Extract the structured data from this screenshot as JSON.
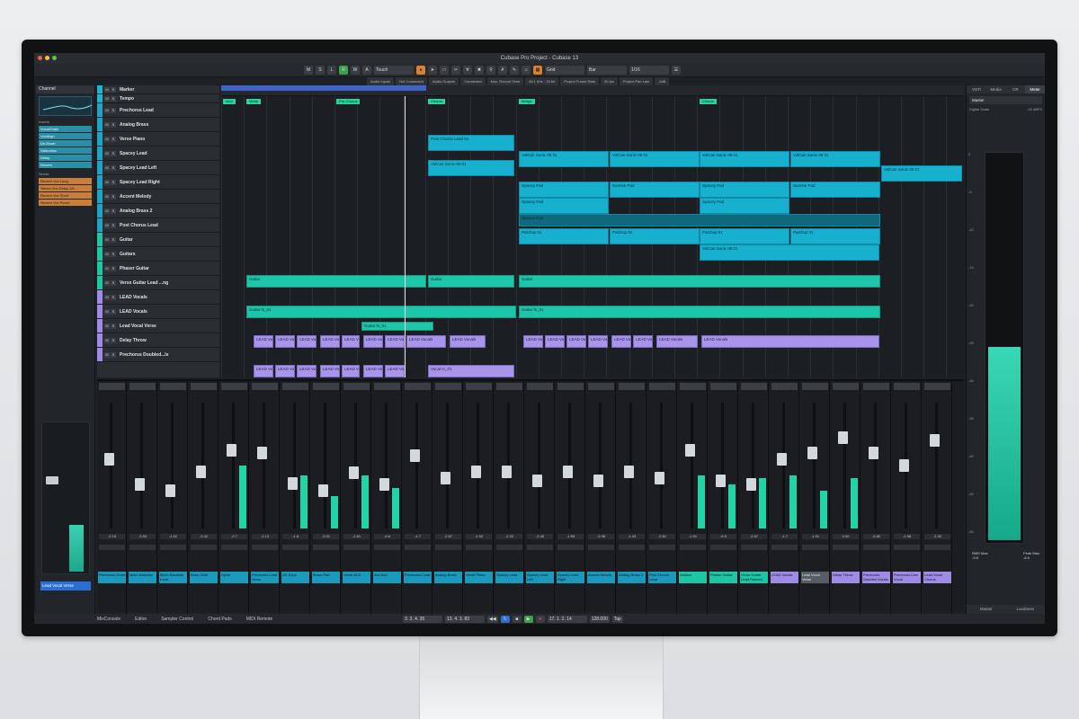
{
  "window": {
    "title": "Cubase Pro Project - Cubase 13"
  },
  "toolbar": {
    "automation_mode": "Touch",
    "snap_type": "Grid",
    "grid_value": "Bar",
    "quantize": "1/16",
    "buttons": [
      "M",
      "S",
      "L",
      "R",
      "W",
      "A"
    ]
  },
  "infobar": {
    "items": [
      "Audio Inputs",
      "Not Connected",
      "Audio Outputs",
      "Connected",
      "Max. Record Time",
      "48.1 kHz - 24 bit",
      "Project Frame Rate",
      "30 fps",
      "Project Pan Law",
      "-3dB"
    ]
  },
  "inspector": {
    "title": "Channel",
    "inserts_label": "Inserts",
    "inserts": [
      "VocalChain",
      "VoxAlign",
      "De-Esser",
      "Saturation",
      "Delay",
      "Reverb"
    ],
    "sends_label": "Sends",
    "sends": [
      "Reverb Vox Long",
      "Stereo Vox Delay 1/8",
      "Reverb Vox Short",
      "Reverb Vox Room"
    ],
    "fader_value": "0.00",
    "channel_name": "Lead Vocal Verse"
  },
  "tracks": [
    {
      "name": "Marker",
      "color": "#1bb7d1"
    },
    {
      "name": "Tempo",
      "color": "#1bb7d1"
    },
    {
      "name": "Prechorus Lead",
      "color": "#1fa3c4"
    },
    {
      "name": "Analog Brass",
      "color": "#1fa3c4"
    },
    {
      "name": "Verse Piano",
      "color": "#1fa3c4"
    },
    {
      "name": "Spacey Lead",
      "color": "#1fa3c4"
    },
    {
      "name": "Spacey Lead Left",
      "color": "#1fa3c4"
    },
    {
      "name": "Spacey Lead Right",
      "color": "#1fa3c4"
    },
    {
      "name": "Accent Melody",
      "color": "#1fa3c4"
    },
    {
      "name": "Analog Brass 2",
      "color": "#1fa3c4"
    },
    {
      "name": "Post Chorus Lead",
      "color": "#1fa3c4"
    },
    {
      "name": "Guitar",
      "color": "#1cc7a5"
    },
    {
      "name": "Guitars",
      "color": "#1cc7a5"
    },
    {
      "name": "Phaser Guitar",
      "color": "#1cc7a5"
    },
    {
      "name": "Verse Guitar Lead ...ng",
      "color": "#1cc7a5"
    },
    {
      "name": "LEAD Vocals",
      "color": "#9f8ae6"
    },
    {
      "name": "LEAD Vocals",
      "color": "#9f8ae6"
    },
    {
      "name": "Lead Vocal Verse",
      "color": "#9f8ae6"
    },
    {
      "name": "Delay Throw",
      "color": "#9f8ae6"
    },
    {
      "name": "Prechorus Doubled...ls",
      "color": "#9f8ae6"
    }
  ],
  "arrange": {
    "markers": [
      "Intro",
      "Verse",
      "Pre-Chorus",
      "Chorus",
      "Bridge",
      "Chorus"
    ],
    "clip_labels": {
      "post_chorus": "Post Chorus Lead 01",
      "volcan": "VolCan Sonic 08 01",
      "spacey": "Spacey Pad",
      "sunrise": "Sunrise Pad",
      "patchup": "Patchup 01",
      "guitar": "Guitar",
      "guitar_hi": "Guitar hi_01",
      "lead_vocals": "LEAD Vocals",
      "vocal_in": "Vocal In_01"
    }
  },
  "mixer": {
    "strips": [
      {
        "name": "Prechorus Dead",
        "value": "-2.15",
        "color": "blue",
        "fader": 0.55,
        "meter": 0
      },
      {
        "name": "Mach Bassline",
        "value": "-3.53",
        "color": "blue",
        "fader": 0.35,
        "meter": 0
      },
      {
        "name": "Mach Bassline Lead",
        "value": "-1.52",
        "color": "blue",
        "fader": 0.3,
        "meter": 0
      },
      {
        "name": "Bass Glide",
        "value": "-3.42",
        "color": "blue",
        "fader": 0.45,
        "meter": 0
      },
      {
        "name": "Synth",
        "value": "-2.7",
        "color": "blue",
        "fader": 0.62,
        "meter": 0.5
      },
      {
        "name": "Prechorus Lead Verse",
        "value": "-1.13",
        "color": "blue",
        "fader": 0.6,
        "meter": 0
      },
      {
        "name": "UK Keys",
        "value": "-1.8",
        "color": "blue",
        "fader": 0.36,
        "meter": 0.42
      },
      {
        "name": "Brass Pad",
        "value": "-3.01",
        "color": "blue",
        "fader": 0.3,
        "meter": 0.26
      },
      {
        "name": "Verse ACD",
        "value": "-2.81",
        "color": "blue",
        "fader": 0.44,
        "meter": 0.42
      },
      {
        "name": "Acc Acd",
        "value": "-6.6",
        "color": "blue",
        "fader": 0.35,
        "meter": 0.32
      },
      {
        "name": "Prechorus Lead",
        "value": "-1.7",
        "color": "blue",
        "fader": 0.58,
        "meter": 0
      },
      {
        "name": "Analog Brass",
        "value": "-2.67",
        "color": "blue",
        "fader": 0.4,
        "meter": 0
      },
      {
        "name": "Verse Piano",
        "value": "-1.52",
        "color": "blue",
        "fader": 0.45,
        "meter": 0
      },
      {
        "name": "Spacey Lead",
        "value": "-2.22",
        "color": "blue",
        "fader": 0.45,
        "meter": 0
      },
      {
        "name": "Spacey Lead Left",
        "value": "-2.45",
        "color": "blue",
        "fader": 0.38,
        "meter": 0
      },
      {
        "name": "Spacey Lead Right",
        "value": "-1.55",
        "color": "blue",
        "fader": 0.45,
        "meter": 0
      },
      {
        "name": "Accent Melody",
        "value": "-2.08",
        "color": "blue",
        "fader": 0.38,
        "meter": 0
      },
      {
        "name": "Analog Brass 2",
        "value": "-1.43",
        "color": "blue",
        "fader": 0.45,
        "meter": 0
      },
      {
        "name": "Post Chorus Lead",
        "value": "-2.81",
        "color": "blue",
        "fader": 0.4,
        "meter": 0
      },
      {
        "name": "Guitars",
        "value": "-1.51",
        "color": "green",
        "fader": 0.62,
        "meter": 0.42
      },
      {
        "name": "Phaser Guitar",
        "value": "-6.5",
        "color": "green",
        "fader": 0.38,
        "meter": 0.35
      },
      {
        "name": "Verse Guitar Lead Panned",
        "value": "-2.67",
        "color": "green",
        "fader": 0.35,
        "meter": 0.4
      },
      {
        "name": "LEAD Vocals",
        "value": "-1.7",
        "color": "purple",
        "fader": 0.55,
        "meter": 0.42
      },
      {
        "name": "Lead Vocal Verse",
        "value": "-1.91",
        "color": "grey",
        "fader": 0.6,
        "meter": 0.3
      },
      {
        "name": "Delay Throw",
        "value": "0.00",
        "color": "purple",
        "fader": 0.72,
        "meter": 0.4
      },
      {
        "name": "Prechorus Doubled Vocals",
        "value": "-5.82",
        "color": "purple",
        "fader": 0.6,
        "meter": 0
      },
      {
        "name": "Prechorus Line Vocal",
        "value": "-1.98",
        "color": "purple",
        "fader": 0.5,
        "meter": 0
      },
      {
        "name": "Lead Vocal Chorus",
        "value": "-2.32",
        "color": "purple",
        "fader": 0.7,
        "meter": 0
      }
    ]
  },
  "right_zone": {
    "tabs": [
      "VSTi",
      "Media",
      "CR",
      "Meter"
    ],
    "active_tab": "Meter",
    "section": "Master",
    "meter_label": "Digital Scale",
    "meter_peak": "-16 dBFS",
    "scale": [
      "0",
      "-6",
      "-10",
      "-15",
      "-20",
      "-25",
      "-30",
      "-35",
      "-40",
      "-45",
      "-50"
    ],
    "rms_label": "RMS Max.",
    "rms_value": "-9.8",
    "peak_label": "Peak Max.",
    "peak_value": "-8.0",
    "level": 0.5,
    "bottom_tabs": [
      "Master",
      "Loudness"
    ]
  },
  "bottombar": {
    "tabs": [
      "MixConsole",
      "Editor",
      "Sampler Control",
      "Chord Pads",
      "MIDI Remote"
    ],
    "left_locator": "3. 3. 4. 35",
    "right_locator": "13. 4. 3. 83",
    "position": "17. 1. 2. 14",
    "tempo": "128.000",
    "tap": "Tap"
  },
  "colors": {
    "accent_blue": "#17b0cf",
    "accent_green": "#1ec6a9",
    "accent_purple": "#a895ea",
    "cycle": "#3f63c7",
    "orange": "#d8822f"
  }
}
